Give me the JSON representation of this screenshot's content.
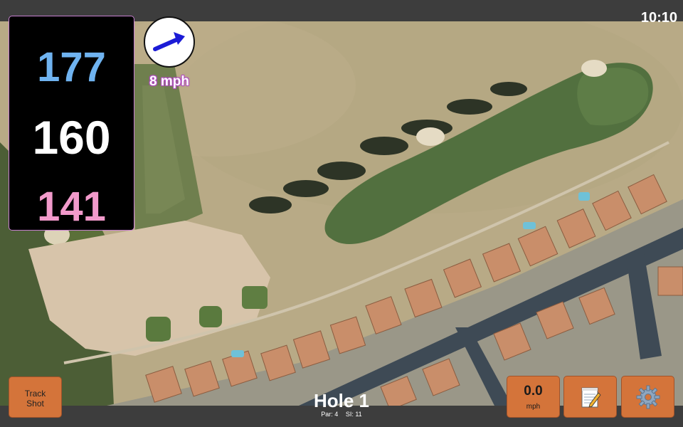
{
  "status": {
    "clock": "10:10"
  },
  "distances": {
    "back": "177",
    "middle": "160",
    "front": "141",
    "colors": {
      "back": "#6fb3f0",
      "middle": "#ffffff",
      "front": "#f29acb"
    }
  },
  "wind": {
    "speed_label": "8 mph",
    "direction_icon": "arrow-icon"
  },
  "hole": {
    "title": "Hole 1",
    "par": "Par: 4",
    "stroke_index": "SI: 11"
  },
  "buttons": {
    "track_shot_line1": "Track",
    "track_shot_line2": "Shot",
    "speed_value": "0.0",
    "speed_unit": "mph",
    "notes_icon": "notepad-icon",
    "settings_icon": "gear-icon"
  },
  "theme": {
    "accent": "#d4743a",
    "panel_border": "#c77fd1",
    "bar": "#3d3d3d"
  }
}
